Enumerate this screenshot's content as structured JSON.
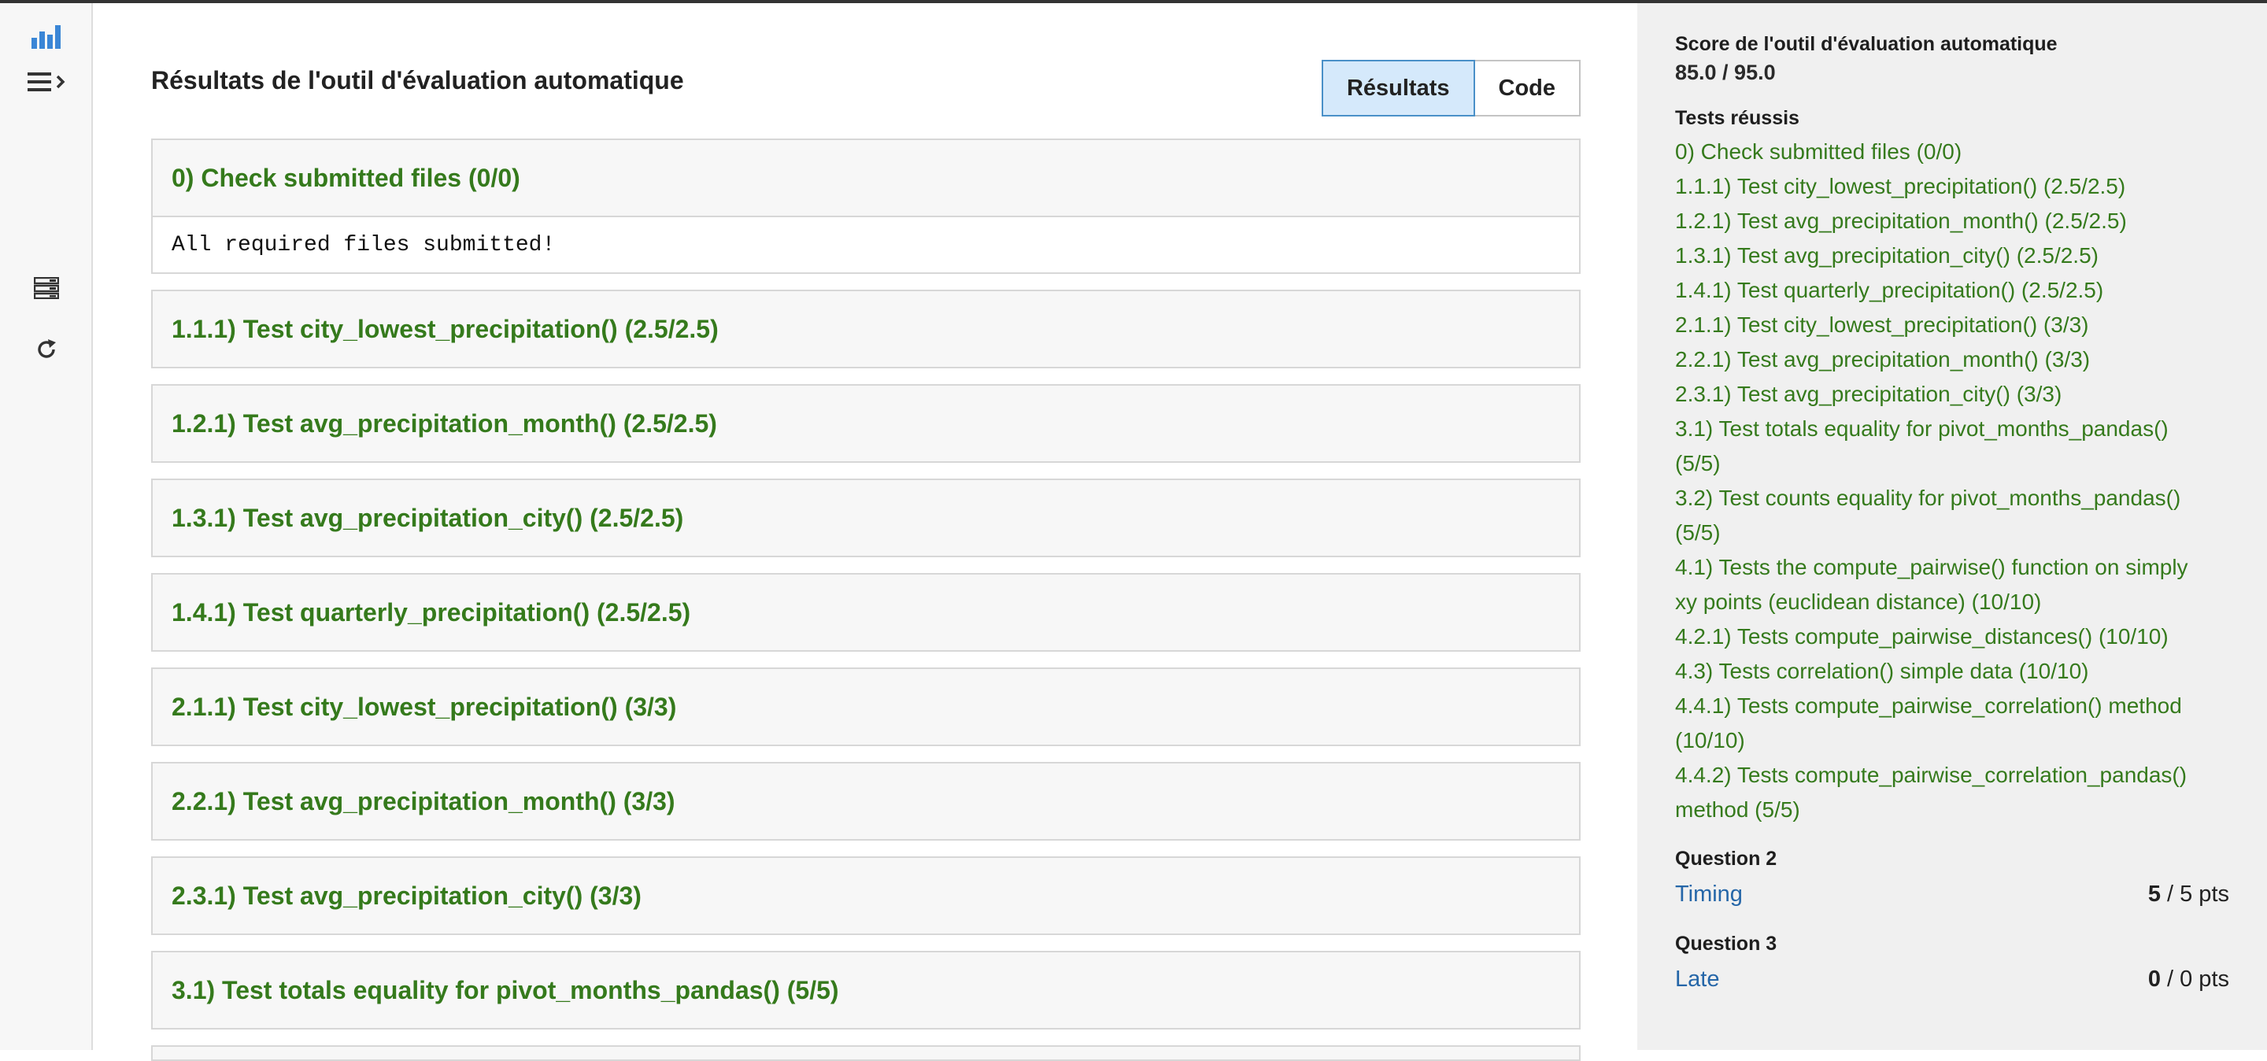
{
  "header": {
    "title": "Résultats de l'outil d'évaluation automatique",
    "tabs": [
      {
        "label": "Résultats",
        "active": true
      },
      {
        "label": "Code",
        "active": false
      }
    ]
  },
  "icons": [
    "bar-chart-icon",
    "menu-expand-icon",
    "server-icon",
    "refresh-icon"
  ],
  "results": [
    {
      "title": "0) Check submitted files (0/0)",
      "output": "All required files submitted!"
    },
    {
      "title": "1.1.1) Test city_lowest_precipitation() (2.5/2.5)"
    },
    {
      "title": "1.2.1) Test avg_precipitation_month() (2.5/2.5)"
    },
    {
      "title": "1.3.1) Test avg_precipitation_city() (2.5/2.5)"
    },
    {
      "title": "1.4.1) Test quarterly_precipitation() (2.5/2.5)"
    },
    {
      "title": "2.1.1) Test city_lowest_precipitation() (3/3)"
    },
    {
      "title": "2.2.1) Test avg_precipitation_month() (3/3)"
    },
    {
      "title": "2.3.1) Test avg_precipitation_city() (3/3)"
    },
    {
      "title": "3.1) Test totals equality for pivot_months_pandas() (5/5)"
    }
  ],
  "sidebar": {
    "score_label": "Score de l'outil d'évaluation automatique",
    "score": "85.0 / 95.0",
    "passed_label": "Tests réussis",
    "passed_tests": [
      [
        "0) Check submitted files (0/0)"
      ],
      [
        "1.1.1) Test city_lowest_precipitation() (2.5/2.5)"
      ],
      [
        "1.2.1) Test avg_precipitation_month() (2.5/2.5)"
      ],
      [
        "1.3.1) Test avg_precipitation_city() (2.5/2.5)"
      ],
      [
        "1.4.1) Test quarterly_precipitation() (2.5/2.5)"
      ],
      [
        "2.1.1) Test city_lowest_precipitation() (3/3)"
      ],
      [
        "2.2.1) Test avg_precipitation_month() (3/3)"
      ],
      [
        "2.3.1) Test avg_precipitation_city() (3/3)"
      ],
      [
        "3.1) Test totals equality for pivot_months_pandas()",
        "(5/5)"
      ],
      [
        "3.2) Test counts equality for pivot_months_pandas()",
        "(5/5)"
      ],
      [
        "4.1) Tests the compute_pairwise() function on simply",
        "xy points (euclidean distance) (10/10)"
      ],
      [
        "4.2.1) Tests compute_pairwise_distances() (10/10)"
      ],
      [
        "4.3) Tests correlation() simple data (10/10)"
      ],
      [
        "4.4.1) Tests compute_pairwise_correlation() method",
        "(10/10)"
      ],
      [
        "4.4.2) Tests compute_pairwise_correlation_pandas()",
        "method (5/5)"
      ]
    ],
    "questions": [
      {
        "label": "Question 2",
        "name": "Timing",
        "earned": "5",
        "total": " / 5 pts"
      },
      {
        "label": "Question 3",
        "name": "Late",
        "earned": "0",
        "total": " / 0 pts"
      }
    ]
  },
  "colors": {
    "passed_green": "#357a1c",
    "link_blue": "#2566a8",
    "active_tab_bg": "#d5e9fb",
    "icon_blue": "#3a86d6"
  }
}
